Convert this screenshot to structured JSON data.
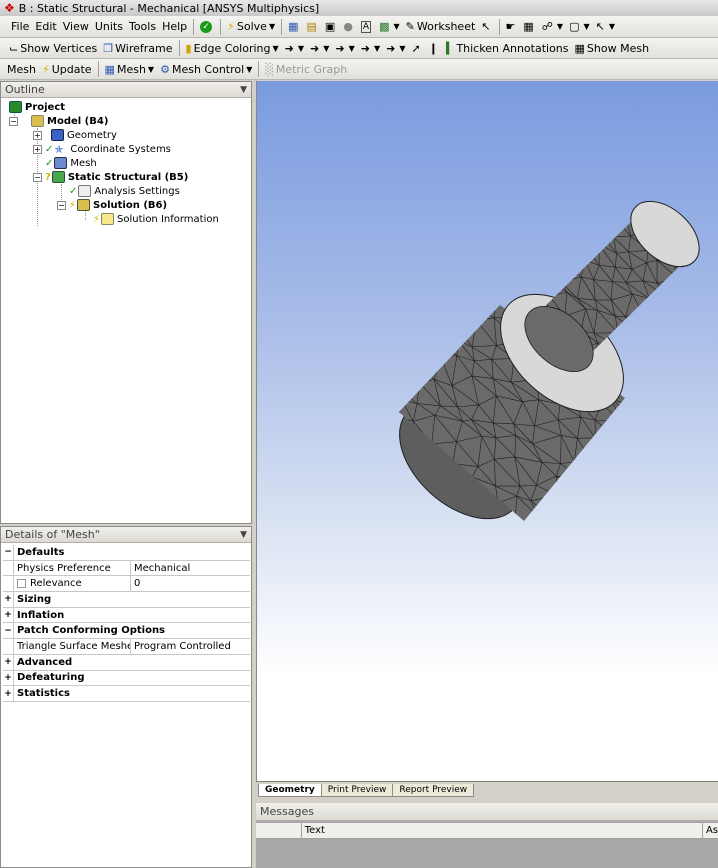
{
  "window": {
    "title": "B : Static Structural - Mechanical [ANSYS Multiphysics]"
  },
  "menu": {
    "items": [
      "File",
      "Edit",
      "View",
      "Units",
      "Tools",
      "Help"
    ],
    "solve_label": "Solve",
    "worksheet_label": "Worksheet"
  },
  "toolbar2": {
    "show_vertices": "Show Vertices",
    "wireframe": "Wireframe",
    "edge_coloring": "Edge Coloring",
    "thicken_annotations": "Thicken Annotations",
    "show_mesh": "Show Mesh"
  },
  "toolbar3": {
    "mesh": "Mesh",
    "update": "Update",
    "mesh_dropdown": "Mesh",
    "mesh_control": "Mesh Control",
    "metric_graph": "Metric Graph"
  },
  "outline": {
    "title": "Outline",
    "nodes": {
      "project": "Project",
      "model": "Model (B4)",
      "geometry": "Geometry",
      "coordinate_systems": "Coordinate Systems",
      "mesh": "Mesh",
      "static_structural": "Static Structural (B5)",
      "analysis_settings": "Analysis Settings",
      "solution": "Solution (B6)",
      "solution_information": "Solution Information"
    }
  },
  "details": {
    "title": "Details of \"Mesh\"",
    "defaults_label": "Defaults",
    "physics_preference_label": "Physics Preference",
    "physics_preference_value": "Mechanical",
    "relevance_label": "Relevance",
    "relevance_value": "0",
    "sizing_label": "Sizing",
    "inflation_label": "Inflation",
    "patch_conforming_label": "Patch Conforming Options",
    "triangle_surface_mesher_label": "Triangle Surface Mesher",
    "triangle_surface_mesher_value": "Program Controlled",
    "advanced_label": "Advanced",
    "defeaturing_label": "Defeaturing",
    "statistics_label": "Statistics"
  },
  "viewport_tabs": [
    "Geometry",
    "Print Preview",
    "Report Preview"
  ],
  "messages": {
    "title": "Messages",
    "col_text": "Text",
    "col_association": "As"
  },
  "colors": {
    "viewport_top": "#7a9be0",
    "mesh_fill": "#6e6e6e",
    "mesh_lines": "#1e1e1e",
    "cut_face": "#d8d8d8",
    "check_green": "#1a9a1a",
    "lightning_yellow": "#d8b000"
  }
}
